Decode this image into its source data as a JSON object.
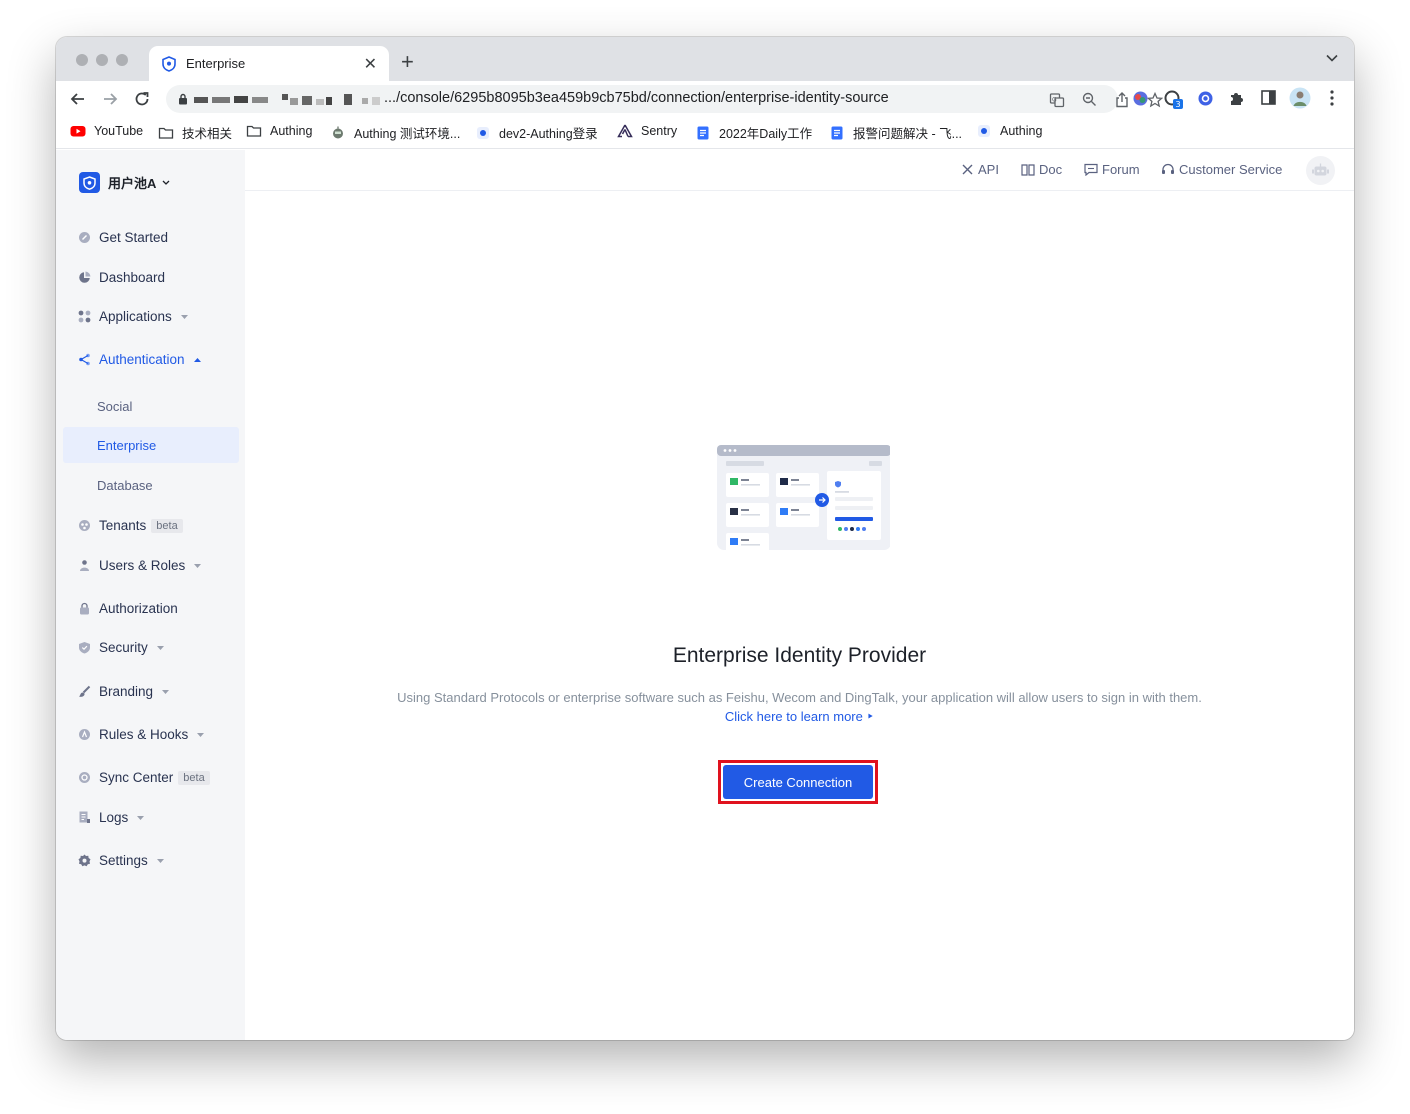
{
  "browser": {
    "tab_title": "Enterprise",
    "url": ".../console/6295b8095b3ea459b9cb75bd/connection/enterprise-identity-source",
    "extension_badge": "3",
    "bookmarks": [
      {
        "label": "YouTube",
        "icon": "youtube-icon"
      },
      {
        "label": "技术相关",
        "icon": "folder-icon"
      },
      {
        "label": "Authing",
        "icon": "folder-icon"
      },
      {
        "label": "Authing 测试环境...",
        "icon": "robot-icon"
      },
      {
        "label": "dev2-Authing登录",
        "icon": "authing-icon"
      },
      {
        "label": "Sentry",
        "icon": "sentry-icon"
      },
      {
        "label": "2022年Daily工作",
        "icon": "doc-icon"
      },
      {
        "label": "报警问题解决 - 飞...",
        "icon": "doc-icon"
      },
      {
        "label": "Authing",
        "icon": "authing-icon"
      }
    ]
  },
  "sidebar": {
    "pool_name": "用户池A",
    "items": [
      {
        "label": "Get Started"
      },
      {
        "label": "Dashboard"
      },
      {
        "label": "Applications"
      },
      {
        "label": "Authentication"
      },
      {
        "label": "Social"
      },
      {
        "label": "Enterprise"
      },
      {
        "label": "Database"
      },
      {
        "label": "Tenants",
        "badge": "beta"
      },
      {
        "label": "Users & Roles"
      },
      {
        "label": "Authorization"
      },
      {
        "label": "Security"
      },
      {
        "label": "Branding"
      },
      {
        "label": "Rules & Hooks"
      },
      {
        "label": "Sync Center",
        "badge": "beta"
      },
      {
        "label": "Logs"
      },
      {
        "label": "Settings"
      }
    ]
  },
  "topbar": {
    "links": [
      "API",
      "Doc",
      "Forum",
      "Customer Service"
    ]
  },
  "main": {
    "title": "Enterprise Identity Provider",
    "description": "Using Standard Protocols or enterprise software such as Feishu, Wecom and DingTalk, your application will allow users to sign in with them.",
    "learn_more": "Click here to learn more ‣",
    "create_button": "Create Connection"
  },
  "colors": {
    "accent": "#215ae5",
    "highlight_box": "#e0121e",
    "sidebar_bg": "#f5f6f8"
  }
}
